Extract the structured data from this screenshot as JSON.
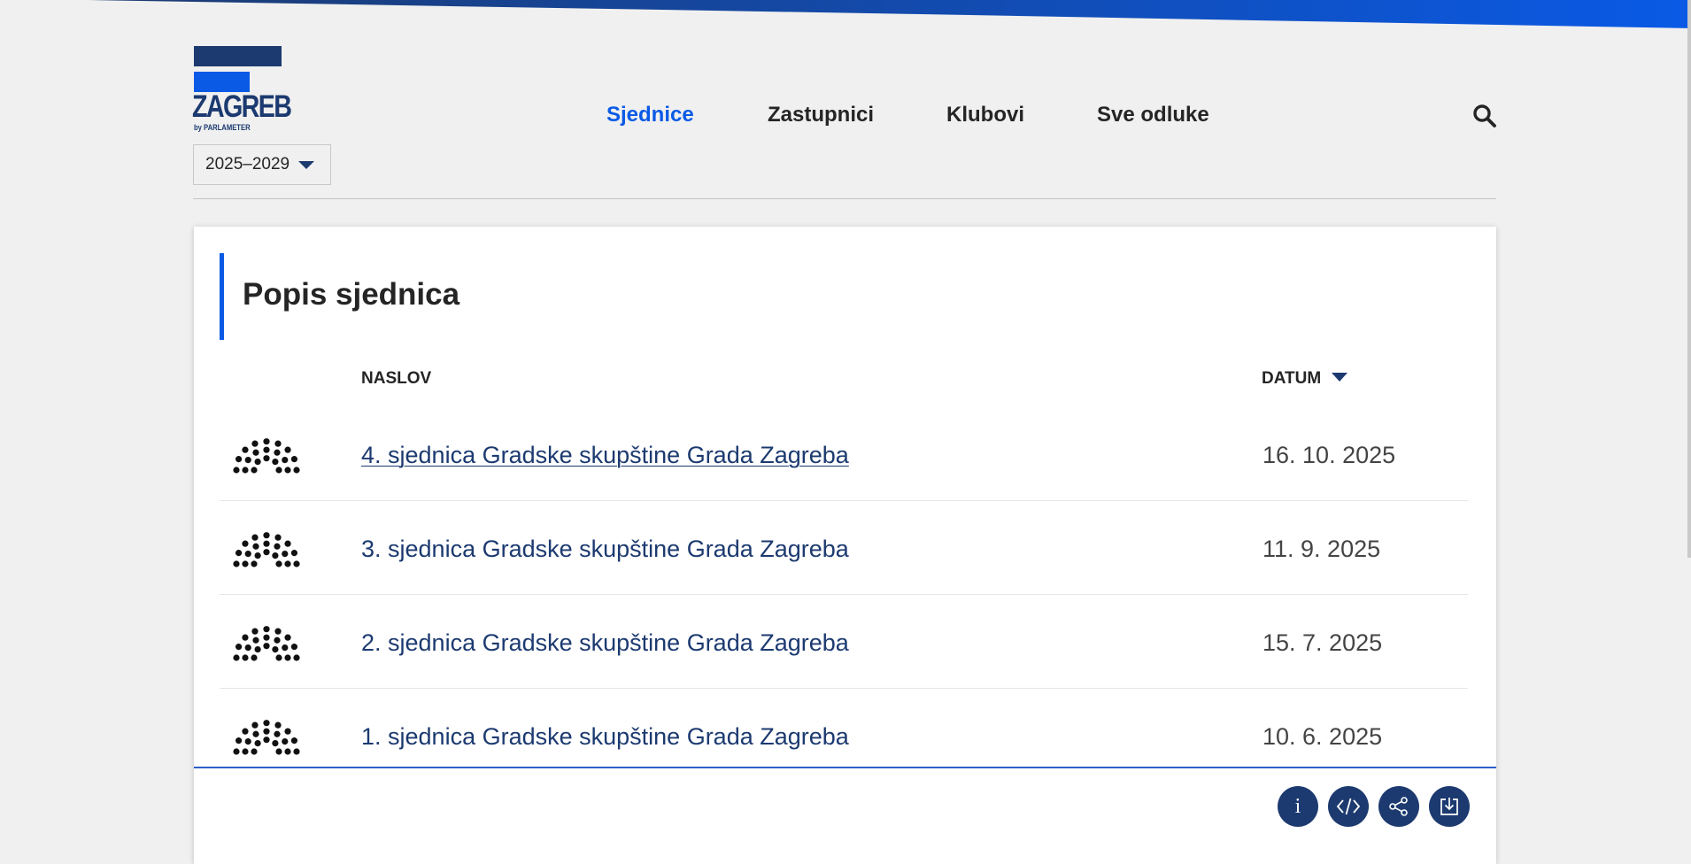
{
  "logo": {
    "wordmark": "ZAGREB",
    "tagline": "by PARLAMETER"
  },
  "term_selector": {
    "value": "2025–2029"
  },
  "nav": {
    "items": [
      {
        "label": "Sjednice",
        "active": true
      },
      {
        "label": "Zastupnici",
        "active": false
      },
      {
        "label": "Klubovi",
        "active": false
      },
      {
        "label": "Sve odluke",
        "active": false
      }
    ],
    "search_icon": "search-icon"
  },
  "card": {
    "title": "Popis sjednica",
    "columns": {
      "title": "NASLOV",
      "date": "DATUM"
    },
    "sort": {
      "column": "date",
      "direction": "descending"
    },
    "sessions": [
      {
        "title": "4. sjednica Gradske skupštine Grada Zagreba",
        "date": "16. 10. 2025"
      },
      {
        "title": "3. sjednica Gradske skupštine Grada Zagreba",
        "date": "11. 9. 2025"
      },
      {
        "title": "2. sjednica Gradske skupštine Grada Zagreba",
        "date": "15. 7. 2025"
      },
      {
        "title": "1. sjednica Gradske skupštine Grada Zagreba",
        "date": "10. 6. 2025"
      }
    ],
    "row_icon": "parliament-seats-icon",
    "actions": [
      {
        "name": "info",
        "icon": "info-icon",
        "glyph": "i"
      },
      {
        "name": "embed",
        "icon": "code-icon"
      },
      {
        "name": "share",
        "icon": "share-icon"
      },
      {
        "name": "download",
        "icon": "download-icon"
      }
    ]
  },
  "colors": {
    "background": "#f0f0f0",
    "navy": "#1c3a70",
    "accent_blue": "#0a5ae6",
    "text": "#252525"
  }
}
